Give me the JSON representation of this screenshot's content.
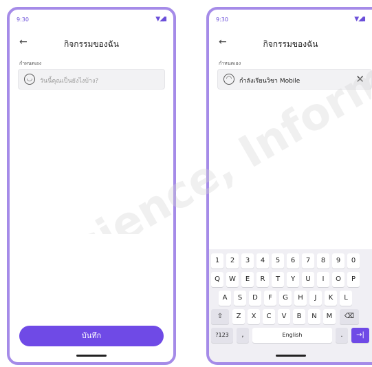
{
  "screens": {
    "left": {
      "status_time": "9:30",
      "back_glyph": "←",
      "title": "กิจกรรมของฉัน",
      "section_label": "กำหนดเอง",
      "input": {
        "placeholder": "วันนี้คุณเป็นยังไงบ้าง?",
        "icon": "smiley-icon"
      },
      "save_label": "บันทึก"
    },
    "right": {
      "status_time": "9:30",
      "back_glyph": "←",
      "title": "กิจกรรมของฉัน",
      "section_label": "กำหนดเอง",
      "input": {
        "value": "กำลังเรียนวิชา Mobile",
        "icon": "emoji-icon"
      },
      "clear_glyph": "✕"
    }
  },
  "keyboard": {
    "rows": [
      [
        "1",
        "2",
        "3",
        "4",
        "5",
        "6",
        "7",
        "8",
        "9",
        "0"
      ],
      [
        "Q",
        "W",
        "E",
        "R",
        "T",
        "Y",
        "U",
        "I",
        "O",
        "P"
      ],
      [
        "A",
        "S",
        "D",
        "F",
        "G",
        "H",
        "J",
        "K",
        "L"
      ],
      [
        "⇧",
        "Z",
        "X",
        "C",
        "V",
        "B",
        "N",
        "M",
        "⌫"
      ],
      [
        "?123",
        ",",
        "English",
        ".",
        "→|"
      ]
    ]
  },
  "watermark_text": "Science, Informatics, Man",
  "colors": {
    "accent": "#6f4ae6",
    "frame": "#a58be8"
  }
}
